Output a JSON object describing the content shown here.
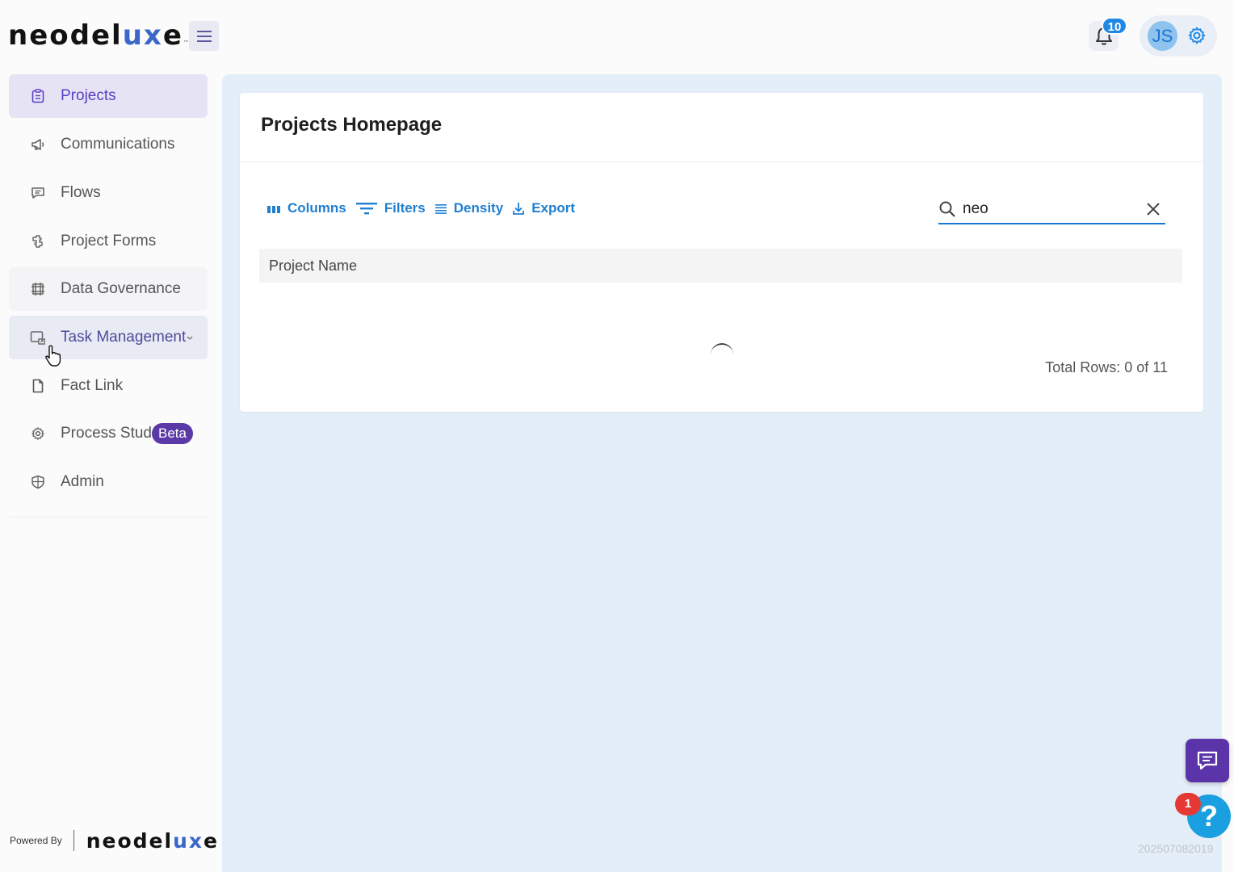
{
  "brand": {
    "logo_main": "neodel",
    "logo_accent": "ux",
    "logo_end": "e",
    "logo_tm": "™"
  },
  "header": {
    "notification_count": "10",
    "avatar_initials": "JS"
  },
  "sidebar": {
    "items": [
      {
        "label": "Projects",
        "icon": "clipboard-icon",
        "state": "active"
      },
      {
        "label": "Communications",
        "icon": "megaphone-icon",
        "state": "default"
      },
      {
        "label": "Flows",
        "icon": "message-square-icon",
        "state": "default"
      },
      {
        "label": "Project Forms",
        "icon": "puzzle-icon",
        "state": "default"
      },
      {
        "label": "Data Governance",
        "icon": "grid-hash-icon",
        "state": "soft"
      },
      {
        "label": "Task Management",
        "icon": "task-share-icon",
        "state": "hover"
      },
      {
        "label": "Fact Link",
        "icon": "document-icon",
        "state": "default"
      },
      {
        "label": "Process Stud",
        "icon": "gear-outline-icon",
        "state": "default",
        "badge": "Beta"
      },
      {
        "label": "Admin",
        "icon": "shield-icon",
        "state": "default"
      }
    ],
    "powered_by": "Powered By"
  },
  "main": {
    "card_title": "Projects Homepage",
    "toolbar": {
      "columns": "Columns",
      "filters": "Filters",
      "density": "Density",
      "export": "Export"
    },
    "search": {
      "value": "neo"
    },
    "grid": {
      "columns": [
        "Project Name"
      ],
      "rows": []
    },
    "total_rows": "Total Rows: 0 of 11"
  },
  "floating": {
    "help_label": "?",
    "help_badge": "1"
  },
  "build_id": "202507082019",
  "colors": {
    "accent_primary": "#1f7fd1",
    "accent_purple": "#5b3fc4",
    "main_bg": "#e4eef8"
  }
}
